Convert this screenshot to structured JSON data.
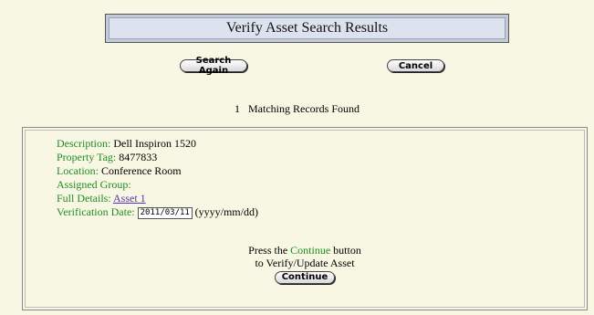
{
  "header": {
    "title": "Verify Asset Search Results"
  },
  "actions": {
    "search_again": "Search Again",
    "cancel": "Cancel"
  },
  "summary": {
    "count": "1",
    "text": "Matching Records Found"
  },
  "record": {
    "description_label": "Description:",
    "description": "Dell Inspiron 1520",
    "property_tag_label": "Property Tag:",
    "property_tag": "8477833",
    "location_label": "Location:",
    "location": "Conference Room",
    "assigned_group_label": "Assigned Group:",
    "assigned_group": "",
    "full_details_label": "Full Details:",
    "full_details_link": "Asset 1",
    "verification_date_label": "Verification Date:",
    "verification_date": "2011/03/11",
    "date_format_hint": "(yyyy/mm/dd)"
  },
  "instruction": {
    "press_the": "Press the",
    "continue_word": "Continue",
    "button_word": "button",
    "line2": "to Verify/Update Asset",
    "continue_button": "Continue"
  },
  "colors": {
    "label_green": "#228b22",
    "link_purple": "#5533aa",
    "background": "#f7f7e4"
  }
}
